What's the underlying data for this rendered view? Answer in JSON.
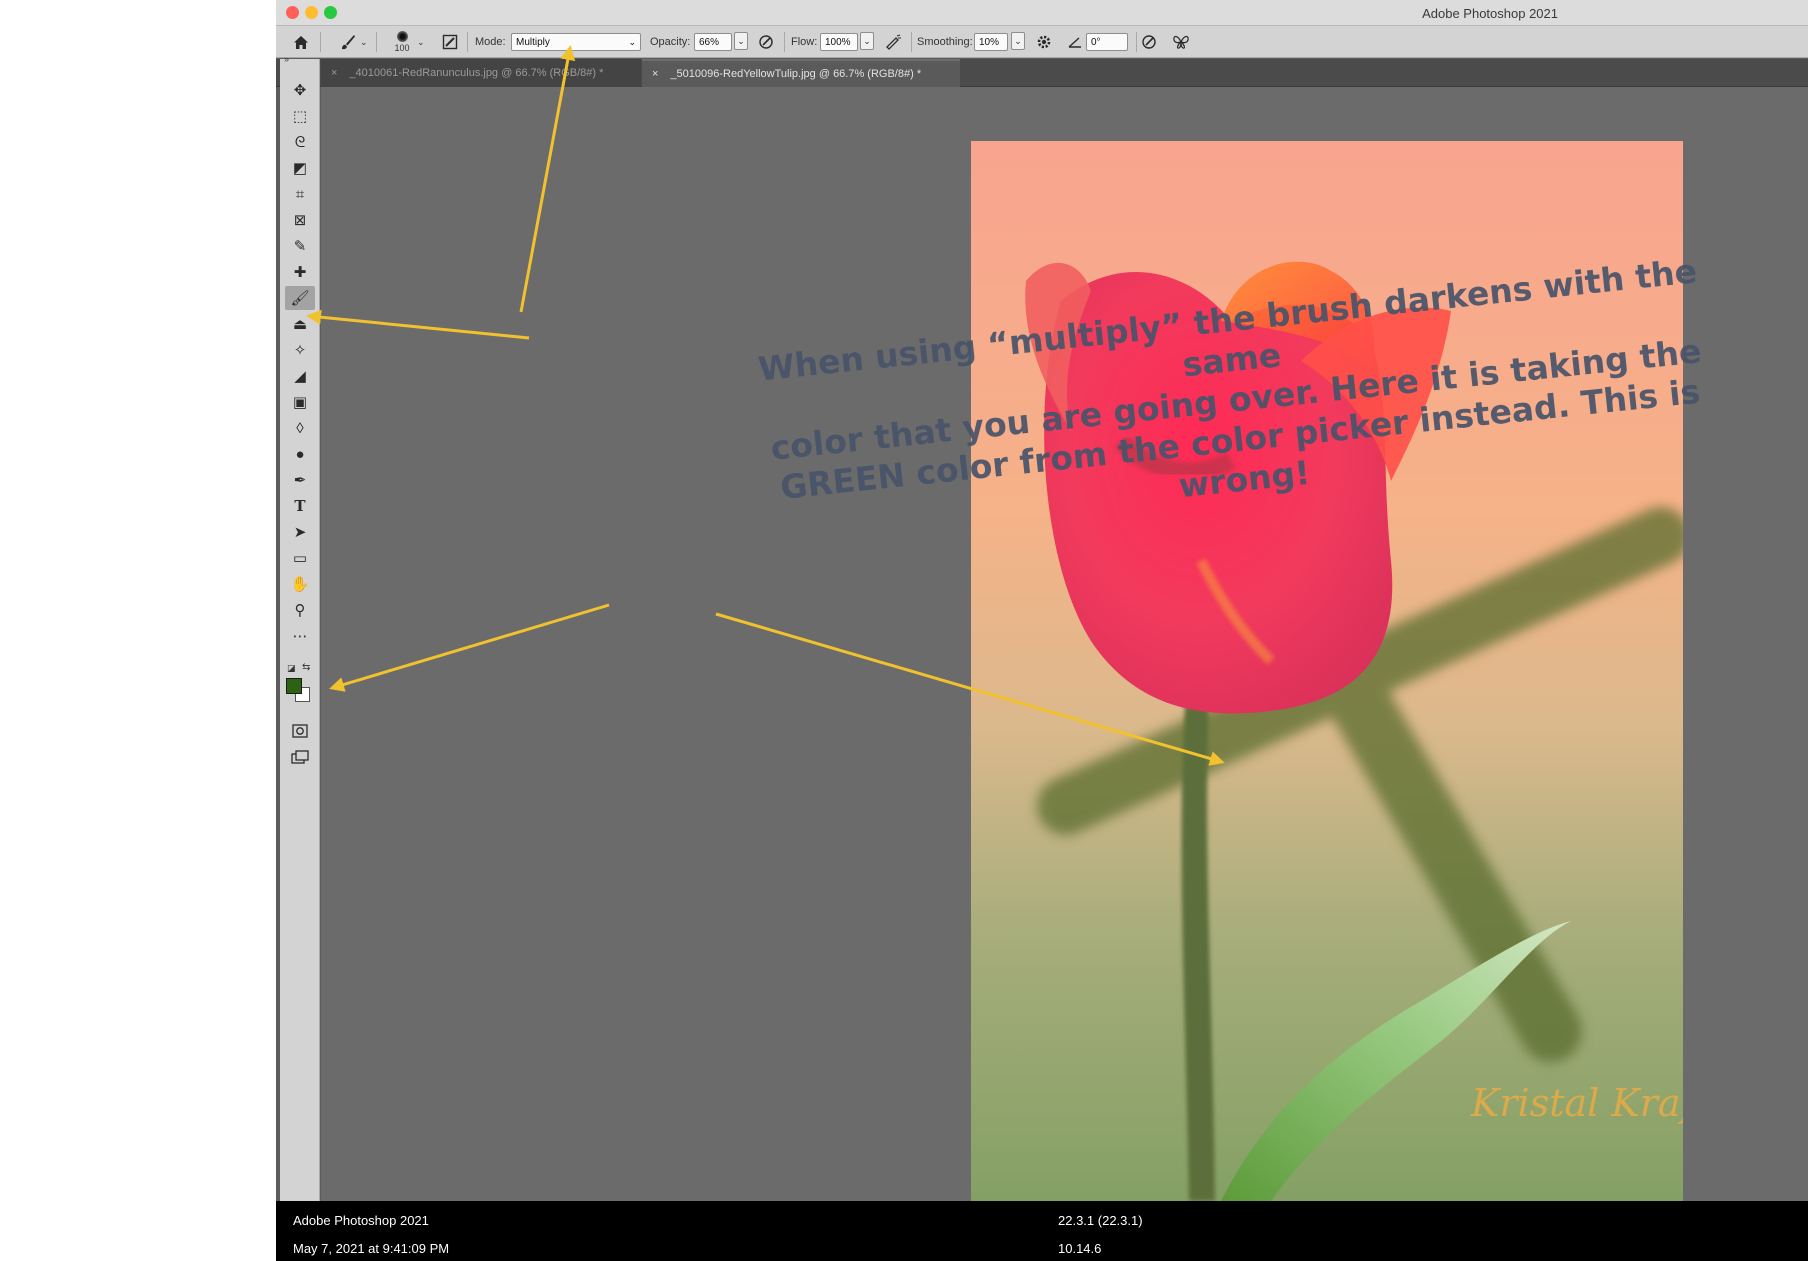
{
  "window": {
    "title": "Adobe Photoshop 2021",
    "traffic_lights": [
      "#fe5f57",
      "#febc2e",
      "#28c840"
    ]
  },
  "options_bar": {
    "brush_size": "100",
    "mode_label": "Mode:",
    "mode_value": "Multiply",
    "opacity_label": "Opacity:",
    "opacity_value": "66%",
    "flow_label": "Flow:",
    "flow_value": "100%",
    "smoothing_label": "Smoothing:",
    "smoothing_value": "10%",
    "angle_value": "0°",
    "dropdown_glyph": "⌄"
  },
  "tabs": [
    {
      "label": "_4010061-RedRanunculus.jpg @ 66.7% (RGB/8#) *",
      "active": false
    },
    {
      "label": "_5010096-RedYellowTulip.jpg @ 66.7% (RGB/8#) *",
      "active": true
    }
  ],
  "tools": [
    {
      "name": "move-tool",
      "icon": "✥"
    },
    {
      "name": "marquee-tool",
      "icon": "⬚"
    },
    {
      "name": "lasso-tool",
      "icon": "ᘓ"
    },
    {
      "name": "object-selection-tool",
      "icon": "◩"
    },
    {
      "name": "crop-tool",
      "icon": "⌗"
    },
    {
      "name": "frame-tool",
      "icon": "⊠"
    },
    {
      "name": "eyedropper-tool",
      "icon": "✎"
    },
    {
      "name": "healing-brush-tool",
      "icon": "✚"
    },
    {
      "name": "brush-tool",
      "icon": "🖌"
    },
    {
      "name": "clone-stamp-tool",
      "icon": "⏏"
    },
    {
      "name": "history-brush-tool",
      "icon": "✧"
    },
    {
      "name": "eraser-tool",
      "icon": "◢"
    },
    {
      "name": "gradient-tool",
      "icon": "▣"
    },
    {
      "name": "blur-tool",
      "icon": "◊"
    },
    {
      "name": "dodge-tool",
      "icon": "●"
    },
    {
      "name": "pen-tool",
      "icon": "✒"
    },
    {
      "name": "type-tool",
      "icon": "T"
    },
    {
      "name": "path-selection-tool",
      "icon": "➤"
    },
    {
      "name": "rectangle-tool",
      "icon": "▭"
    },
    {
      "name": "hand-tool",
      "icon": "✋"
    },
    {
      "name": "zoom-tool",
      "icon": "⚲"
    },
    {
      "name": "more-tools",
      "icon": "⋯"
    }
  ],
  "active_tool": "brush-tool",
  "colors": {
    "foreground": "#2c6312",
    "background": "#ffffff",
    "annotation_arrow": "#f2c12e"
  },
  "annotation": {
    "lines": [
      "When using “multiply” the brush darkens with the same",
      "color that you are going over.  Here it is taking the",
      "GREEN color from the color picker instead. This is",
      "wrong!"
    ]
  },
  "photo": {
    "subject": "red-tulip",
    "signature": "Kristal Kraft"
  },
  "info_bar": {
    "app": "Adobe Photoshop 2021",
    "date": "May 7, 2021 at 9:41:09 PM",
    "version": "22.3.1 (22.3.1)",
    "os": "10.14.6"
  }
}
